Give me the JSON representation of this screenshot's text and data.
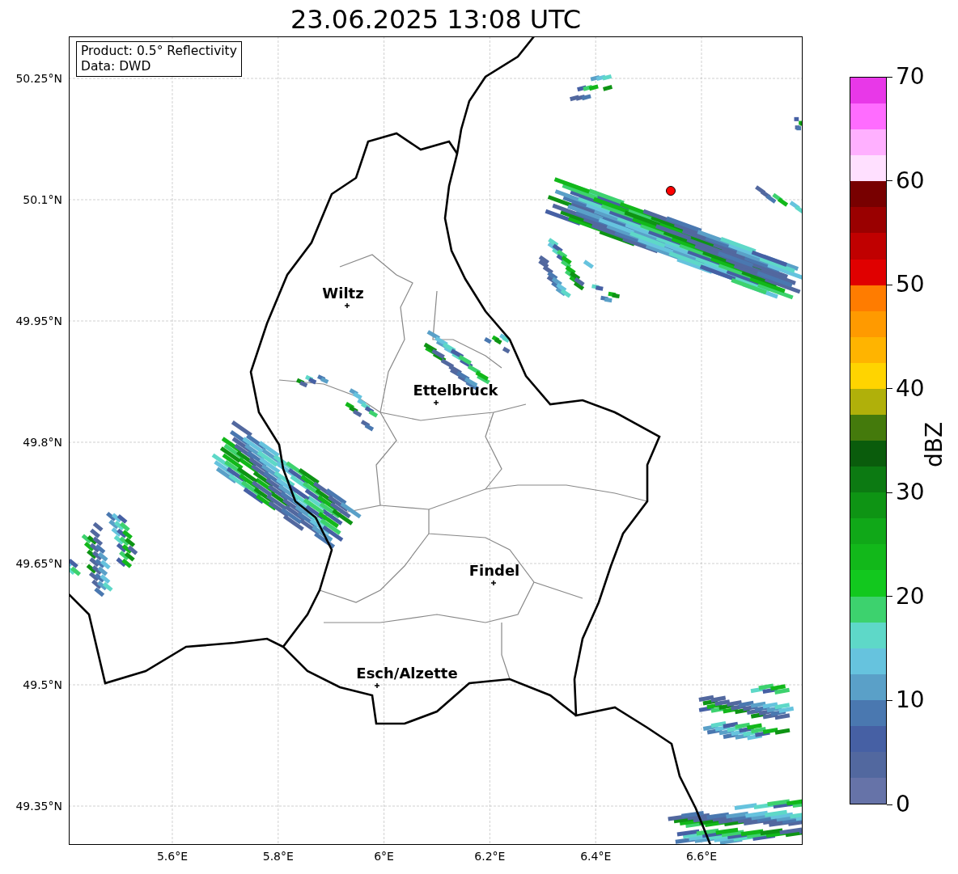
{
  "title": "23.06.2025 13:08 UTC",
  "info_box": [
    "Product: 0.5° Reflectivity",
    "Data: DWD"
  ],
  "map": {
    "y_ticks": [
      "50.25°N",
      "50.1°N",
      "49.95°N",
      "49.8°N",
      "49.65°N",
      "49.5°N",
      "49.35°N"
    ],
    "x_ticks": [
      "5.6°E",
      "5.8°E",
      "6°E",
      "6.2°E",
      "6.4°E",
      "6.6°E"
    ],
    "cities": [
      {
        "name": "Wiltz"
      },
      {
        "name": "Ettelbruck"
      },
      {
        "name": "Findel"
      },
      {
        "name": "Esch/Alzette"
      }
    ]
  },
  "colorbar": {
    "label": "dBZ",
    "ticks": [
      "70",
      "60",
      "50",
      "40",
      "30",
      "20",
      "10",
      "0"
    ],
    "bins": [
      {
        "color": "#e838e8"
      },
      {
        "color": "#ff6cff"
      },
      {
        "color": "#ffb0ff"
      },
      {
        "color": "#ffe0ff"
      },
      {
        "color": "#780000"
      },
      {
        "color": "#9a0000"
      },
      {
        "color": "#c00000"
      },
      {
        "color": "#e00000"
      },
      {
        "color": "#ff7c00"
      },
      {
        "color": "#ff9a00"
      },
      {
        "color": "#ffb400"
      },
      {
        "color": "#ffd400"
      },
      {
        "color": "#b0b00a"
      },
      {
        "color": "#447a0c"
      },
      {
        "color": "#0a5c0c"
      },
      {
        "color": "#0c7a12"
      },
      {
        "color": "#0e9414"
      },
      {
        "color": "#10a818"
      },
      {
        "color": "#12b81a"
      },
      {
        "color": "#12c81e"
      },
      {
        "color": "#3dd26e"
      },
      {
        "color": "#5ed8c8"
      },
      {
        "color": "#66c3de"
      },
      {
        "color": "#5aa0c8"
      },
      {
        "color": "#4a78b0"
      },
      {
        "color": "#4660a4"
      },
      {
        "color": "#52689f"
      },
      {
        "color": "#6673a8"
      }
    ]
  }
}
